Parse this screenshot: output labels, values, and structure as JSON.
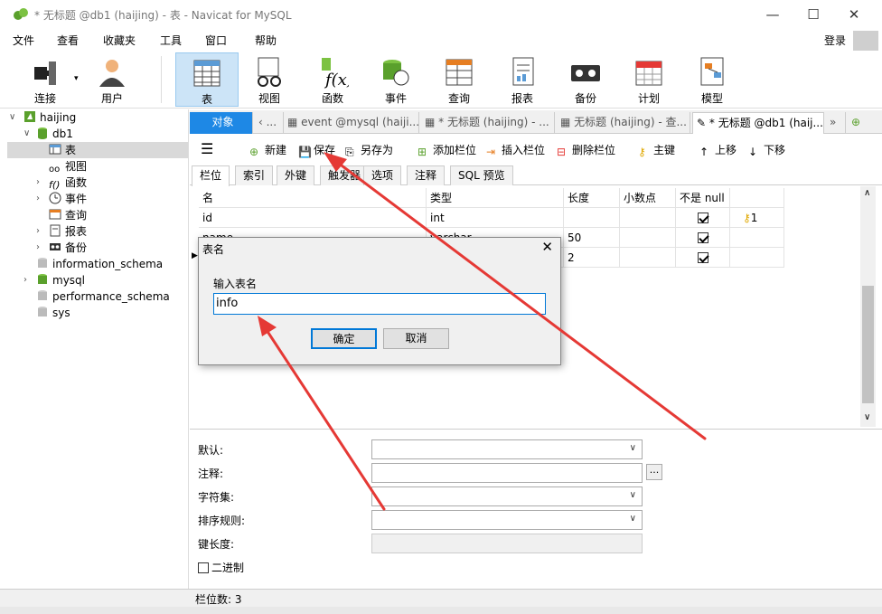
{
  "window": {
    "title": "* 无标题 @db1 (haijing) - 表 - Navicat for MySQL",
    "min": "—",
    "max": "☐",
    "close": "✕"
  },
  "menu": [
    "文件",
    "查看",
    "收藏夹",
    "工具",
    "窗口",
    "帮助"
  ],
  "login": "登录",
  "toolbar": [
    "连接",
    "用户",
    "表",
    "视图",
    "函数",
    "事件",
    "查询",
    "报表",
    "备份",
    "计划",
    "模型"
  ],
  "tree": {
    "connection": "haijing",
    "db": "db1",
    "db_children": [
      "表",
      "视图",
      "函数",
      "事件",
      "查询",
      "报表",
      "备份"
    ],
    "other_dbs": [
      "information_schema",
      "mysql",
      "performance_schema",
      "sys"
    ]
  },
  "tabs": {
    "objects": "对象",
    "t1": "event @mysql (haiji...",
    "t2": "* 无标题 (haijing) - ...",
    "t3": "无标题 (haijing) - 查...",
    "t4": "* 无标题 @db1 (haij..."
  },
  "subtoolbar": {
    "menu_icon": "☰",
    "new": "新建",
    "save": "保存",
    "save_as": "另存为",
    "add_col": "添加栏位",
    "insert_col": "插入栏位",
    "del_col": "删除栏位",
    "pk": "主键",
    "up": "上移",
    "down": "下移"
  },
  "subtabs": [
    "栏位",
    "索引",
    "外键",
    "触发器",
    "选项",
    "注释",
    "SQL 预览"
  ],
  "grid": {
    "headers": [
      "名",
      "类型",
      "长度",
      "小数点",
      "不是 null",
      ""
    ],
    "rows": [
      {
        "name": "id",
        "type": "int",
        "length": "",
        "key": "1"
      },
      {
        "name": "name",
        "type": "varchar",
        "length": "50",
        "key": ""
      },
      {
        "name": "",
        "type": "",
        "length": "2",
        "key": ""
      }
    ]
  },
  "props": {
    "default": "默认:",
    "comment": "注释:",
    "charset": "字符集:",
    "collation": "排序规则:",
    "keylen": "键长度:",
    "binary": "二进制",
    "ellipsis": "..."
  },
  "status": "栏位数: 3",
  "dialog": {
    "title": "表名",
    "label": "输入表名",
    "value": "info",
    "ok": "确定",
    "cancel": "取消",
    "close": "✕"
  },
  "colors": {
    "accent": "#1e88e5",
    "arrow": "#e53935",
    "selected": "#cce4f7"
  }
}
